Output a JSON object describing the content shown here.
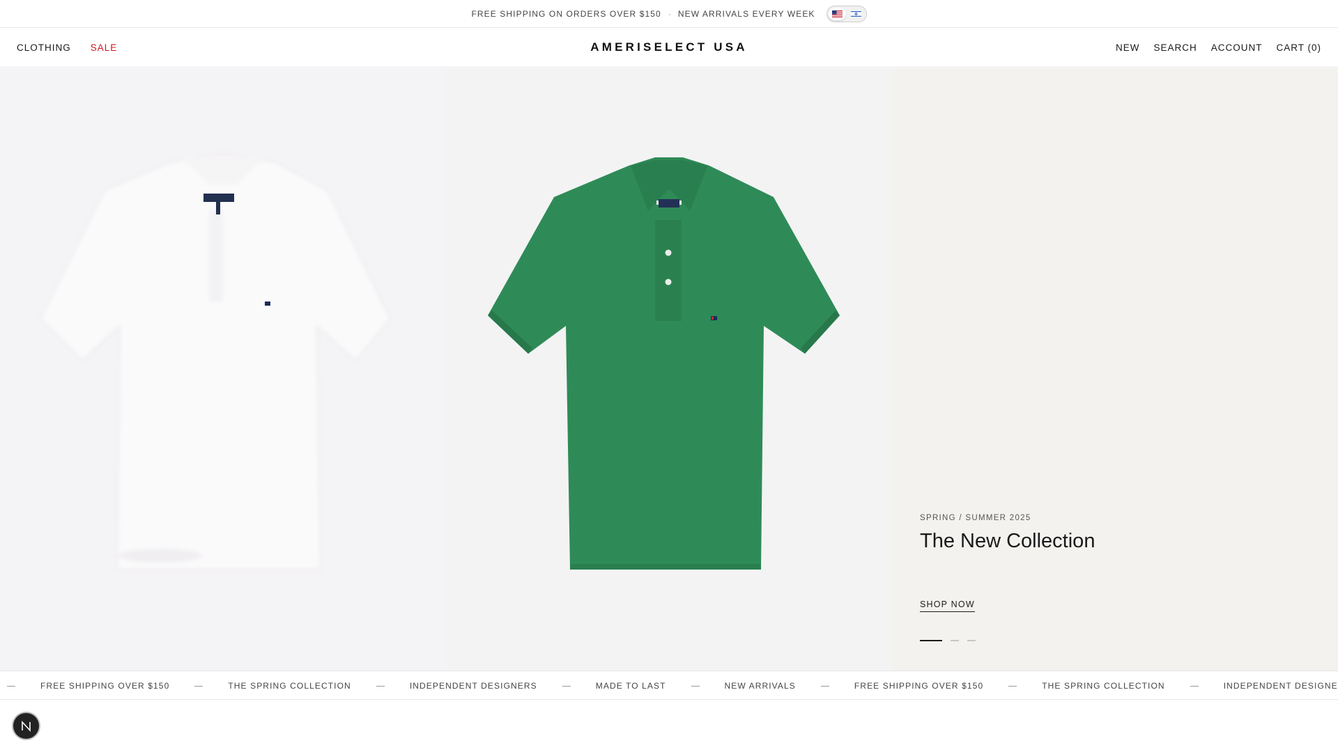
{
  "announcement": {
    "text1": "FREE SHIPPING ON ORDERS OVER $150",
    "separator": "·",
    "text2": "NEW ARRIVALS EVERY WEEK",
    "languages": [
      "us-flag-icon",
      "il-flag-icon"
    ]
  },
  "header": {
    "left_nav": [
      "CLOTHING",
      "SALE"
    ],
    "logo": "AMERISELECT USA",
    "right_nav": [
      "NEW",
      "SEARCH",
      "ACCOUNT",
      "CART (0)"
    ]
  },
  "hero": {
    "eyebrow": "SPRING / SUMMER 2025",
    "title": "The New Collection",
    "cta": "SHOP NOW",
    "slides": {
      "count": 3,
      "active": 1
    }
  },
  "marquee": {
    "items": [
      "FREE SHIPPING OVER $150",
      "THE SPRING COLLECTION",
      "INDEPENDENT DESIGNERS",
      "MADE TO LAST",
      "NEW ARRIVALS",
      "FREE SHIPPING OVER $150",
      "THE SPRING COLLECTION",
      "INDEPENDENT DESIGNERS"
    ]
  },
  "colors": {
    "accent_sale": "#d0151f",
    "polo_green": "#2e8b57",
    "polo_white": "#fafafa"
  },
  "floating_badge": {
    "icon": "n-logo-icon"
  }
}
